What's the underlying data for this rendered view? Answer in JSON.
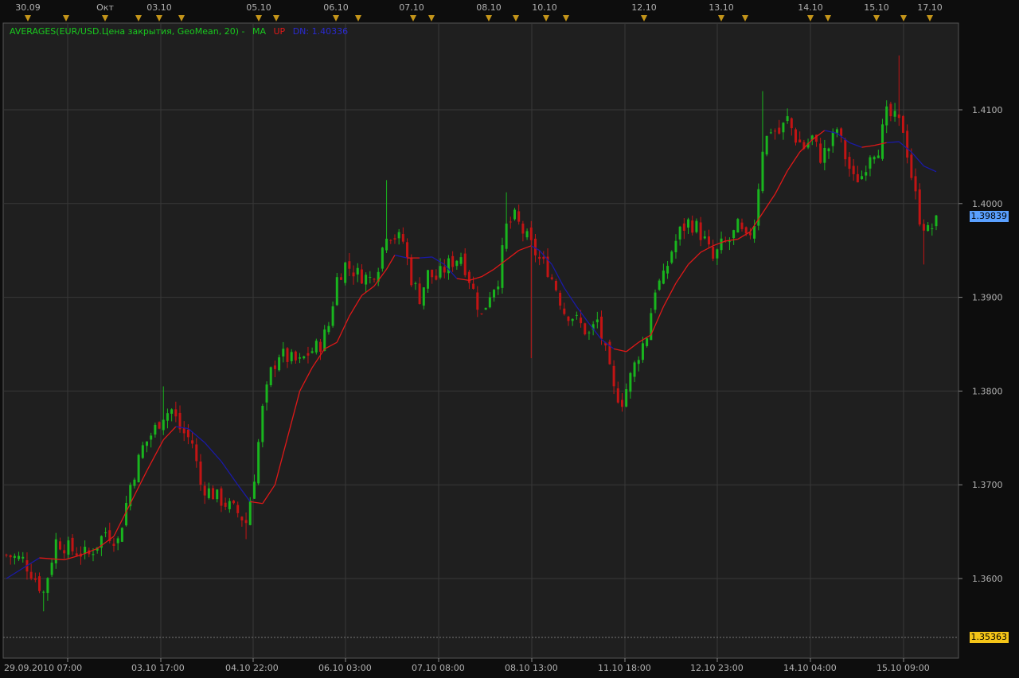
{
  "legend": {
    "indicator": "AVERAGES(EUR/USD.Цена закрытия, GeoMean, 20) -",
    "ma_label": "MA",
    "up_label": "UP",
    "dn_label": "DN: 1.40336"
  },
  "price_tags": {
    "current": "1.39839",
    "low": "1.35363"
  },
  "top_axis_labels": [
    "30.09",
    "Окт",
    "03.10",
    "05.10",
    "06.10",
    "07.10",
    "08.10",
    "10.10",
    "12.10",
    "13.10",
    "14.10",
    "15.10",
    "17.10"
  ],
  "colors": {
    "background": "#0d0d0d",
    "plot_bg": "#1f1f1f",
    "grid": "#383838",
    "up_candle": "#19b51e",
    "down_candle": "#c21414",
    "ma_up": "#e01818",
    "ma_down": "#1a1aa6",
    "legend_text": "#19c81e",
    "marker": "#c4951a",
    "current_tag": "#5aa0ff",
    "low_tag": "#f5c518"
  },
  "chart_data": {
    "type": "candlestick",
    "instrument": "EUR/USD",
    "y_ticks": [
      {
        "value": 1.41,
        "label": "1.4100"
      },
      {
        "value": 1.4,
        "label": "1.4000"
      },
      {
        "value": 1.39,
        "label": "1.3900"
      },
      {
        "value": 1.38,
        "label": "1.3800"
      },
      {
        "value": 1.37,
        "label": "1.3700"
      },
      {
        "value": 1.36,
        "label": "1.3600"
      }
    ],
    "ylim": [
      1.3535,
      1.4195
    ],
    "x_labels": [
      "29.09.2010 07:00",
      "03.10 17:00",
      "04.10 22:00",
      "06.10 03:00",
      "07.10 08:00",
      "08.10 13:00",
      "11.10 18:00",
      "12.10 23:00",
      "14.10 04:00",
      "15.10 09:00"
    ],
    "close_path": [
      {
        "t": 0,
        "v": 1.3625
      },
      {
        "t": 4,
        "v": 1.362
      },
      {
        "t": 7,
        "v": 1.36
      },
      {
        "t": 9,
        "v": 1.3585
      },
      {
        "t": 12,
        "v": 1.364
      },
      {
        "t": 16,
        "v": 1.363
      },
      {
        "t": 20,
        "v": 1.3625
      },
      {
        "t": 24,
        "v": 1.365
      },
      {
        "t": 27,
        "v": 1.364
      },
      {
        "t": 30,
        "v": 1.37
      },
      {
        "t": 33,
        "v": 1.374
      },
      {
        "t": 36,
        "v": 1.376
      },
      {
        "t": 38,
        "v": 1.3775
      },
      {
        "t": 40,
        "v": 1.378
      },
      {
        "t": 42,
        "v": 1.376
      },
      {
        "t": 45,
        "v": 1.3745
      },
      {
        "t": 47,
        "v": 1.37
      },
      {
        "t": 50,
        "v": 1.369
      },
      {
        "t": 53,
        "v": 1.368
      },
      {
        "t": 56,
        "v": 1.367
      },
      {
        "t": 58,
        "v": 1.366
      },
      {
        "t": 60,
        "v": 1.371
      },
      {
        "t": 62,
        "v": 1.378
      },
      {
        "t": 64,
        "v": 1.382
      },
      {
        "t": 66,
        "v": 1.384
      },
      {
        "t": 68,
        "v": 1.3835
      },
      {
        "t": 71,
        "v": 1.383
      },
      {
        "t": 73,
        "v": 1.384
      },
      {
        "t": 76,
        "v": 1.385
      },
      {
        "t": 78,
        "v": 1.387
      },
      {
        "t": 80,
        "v": 1.392
      },
      {
        "t": 82,
        "v": 1.3935
      },
      {
        "t": 85,
        "v": 1.3925
      },
      {
        "t": 88,
        "v": 1.392
      },
      {
        "t": 90,
        "v": 1.3935
      },
      {
        "t": 92,
        "v": 1.397
      },
      {
        "t": 94,
        "v": 1.3965
      },
      {
        "t": 96,
        "v": 1.396
      },
      {
        "t": 98,
        "v": 1.392
      },
      {
        "t": 100,
        "v": 1.39
      },
      {
        "t": 102,
        "v": 1.3925
      },
      {
        "t": 104,
        "v": 1.392
      },
      {
        "t": 107,
        "v": 1.3935
      },
      {
        "t": 110,
        "v": 1.3945
      },
      {
        "t": 112,
        "v": 1.392
      },
      {
        "t": 115,
        "v": 1.388
      },
      {
        "t": 117,
        "v": 1.3905
      },
      {
        "t": 119,
        "v": 1.392
      },
      {
        "t": 121,
        "v": 1.3975
      },
      {
        "t": 123,
        "v": 1.3985
      },
      {
        "t": 125,
        "v": 1.397
      },
      {
        "t": 127,
        "v": 1.3955
      },
      {
        "t": 129,
        "v": 1.394
      },
      {
        "t": 131,
        "v": 1.393
      },
      {
        "t": 133,
        "v": 1.391
      },
      {
        "t": 135,
        "v": 1.3885
      },
      {
        "t": 137,
        "v": 1.388
      },
      {
        "t": 139,
        "v": 1.387
      },
      {
        "t": 141,
        "v": 1.386
      },
      {
        "t": 143,
        "v": 1.3875
      },
      {
        "t": 145,
        "v": 1.384
      },
      {
        "t": 147,
        "v": 1.38
      },
      {
        "t": 149,
        "v": 1.379
      },
      {
        "t": 151,
        "v": 1.3815
      },
      {
        "t": 153,
        "v": 1.384
      },
      {
        "t": 155,
        "v": 1.386
      },
      {
        "t": 157,
        "v": 1.391
      },
      {
        "t": 159,
        "v": 1.392
      },
      {
        "t": 161,
        "v": 1.395
      },
      {
        "t": 163,
        "v": 1.397
      },
      {
        "t": 165,
        "v": 1.398
      },
      {
        "t": 167,
        "v": 1.3975
      },
      {
        "t": 169,
        "v": 1.396
      },
      {
        "t": 171,
        "v": 1.394
      },
      {
        "t": 173,
        "v": 1.3955
      },
      {
        "t": 175,
        "v": 1.396
      },
      {
        "t": 177,
        "v": 1.3975
      },
      {
        "t": 179,
        "v": 1.396
      },
      {
        "t": 181,
        "v": 1.398
      },
      {
        "t": 183,
        "v": 1.406
      },
      {
        "t": 185,
        "v": 1.408
      },
      {
        "t": 187,
        "v": 1.4075
      },
      {
        "t": 189,
        "v": 1.409
      },
      {
        "t": 191,
        "v": 1.407
      },
      {
        "t": 193,
        "v": 1.406
      },
      {
        "t": 195,
        "v": 1.407
      },
      {
        "t": 197,
        "v": 1.405
      },
      {
        "t": 199,
        "v": 1.406
      },
      {
        "t": 201,
        "v": 1.408
      },
      {
        "t": 203,
        "v": 1.405
      },
      {
        "t": 205,
        "v": 1.4025
      },
      {
        "t": 207,
        "v": 1.403
      },
      {
        "t": 209,
        "v": 1.4055
      },
      {
        "t": 211,
        "v": 1.406
      },
      {
        "t": 213,
        "v": 1.4095
      },
      {
        "t": 215,
        "v": 1.409
      },
      {
        "t": 217,
        "v": 1.408
      },
      {
        "t": 219,
        "v": 1.403
      },
      {
        "t": 221,
        "v": 1.3985
      },
      {
        "t": 223,
        "v": 1.397
      },
      {
        "t": 225,
        "v": 1.398
      }
    ],
    "ma_points": [
      {
        "t": 0,
        "v": 1.36,
        "trend": "down"
      },
      {
        "t": 8,
        "v": 1.3622,
        "trend": "down"
      },
      {
        "t": 14,
        "v": 1.362,
        "trend": "up"
      },
      {
        "t": 18,
        "v": 1.3625,
        "trend": "up"
      },
      {
        "t": 22,
        "v": 1.3632,
        "trend": "up"
      },
      {
        "t": 26,
        "v": 1.3645,
        "trend": "up"
      },
      {
        "t": 30,
        "v": 1.368,
        "trend": "up"
      },
      {
        "t": 34,
        "v": 1.3715,
        "trend": "up"
      },
      {
        "t": 38,
        "v": 1.3748,
        "trend": "up"
      },
      {
        "t": 41,
        "v": 1.3762,
        "trend": "up"
      },
      {
        "t": 44,
        "v": 1.376,
        "trend": "down"
      },
      {
        "t": 48,
        "v": 1.3745,
        "trend": "down"
      },
      {
        "t": 52,
        "v": 1.3725,
        "trend": "down"
      },
      {
        "t": 56,
        "v": 1.37,
        "trend": "down"
      },
      {
        "t": 59,
        "v": 1.3682,
        "trend": "down"
      },
      {
        "t": 62,
        "v": 1.368,
        "trend": "up"
      },
      {
        "t": 65,
        "v": 1.37,
        "trend": "up"
      },
      {
        "t": 68,
        "v": 1.375,
        "trend": "up"
      },
      {
        "t": 71,
        "v": 1.38,
        "trend": "up"
      },
      {
        "t": 74,
        "v": 1.3825,
        "trend": "up"
      },
      {
        "t": 77,
        "v": 1.3845,
        "trend": "up"
      },
      {
        "t": 80,
        "v": 1.3852,
        "trend": "up"
      },
      {
        "t": 83,
        "v": 1.388,
        "trend": "up"
      },
      {
        "t": 86,
        "v": 1.3902,
        "trend": "up"
      },
      {
        "t": 89,
        "v": 1.3912,
        "trend": "up"
      },
      {
        "t": 92,
        "v": 1.393,
        "trend": "up"
      },
      {
        "t": 94,
        "v": 1.3945,
        "trend": "up"
      },
      {
        "t": 97,
        "v": 1.3942,
        "trend": "down"
      },
      {
        "t": 100,
        "v": 1.3942,
        "trend": "up"
      },
      {
        "t": 103,
        "v": 1.3943,
        "trend": "down"
      },
      {
        "t": 106,
        "v": 1.3935,
        "trend": "down"
      },
      {
        "t": 109,
        "v": 1.392,
        "trend": "down"
      },
      {
        "t": 112,
        "v": 1.3918,
        "trend": "up"
      },
      {
        "t": 115,
        "v": 1.3922,
        "trend": "up"
      },
      {
        "t": 118,
        "v": 1.393,
        "trend": "up"
      },
      {
        "t": 121,
        "v": 1.394,
        "trend": "up"
      },
      {
        "t": 124,
        "v": 1.395,
        "trend": "up"
      },
      {
        "t": 127,
        "v": 1.3955,
        "trend": "up"
      },
      {
        "t": 129,
        "v": 1.395,
        "trend": "down"
      },
      {
        "t": 132,
        "v": 1.3935,
        "trend": "down"
      },
      {
        "t": 135,
        "v": 1.391,
        "trend": "down"
      },
      {
        "t": 138,
        "v": 1.389,
        "trend": "down"
      },
      {
        "t": 141,
        "v": 1.3872,
        "trend": "down"
      },
      {
        "t": 144,
        "v": 1.3855,
        "trend": "down"
      },
      {
        "t": 147,
        "v": 1.3845,
        "trend": "down"
      },
      {
        "t": 150,
        "v": 1.3842,
        "trend": "up"
      },
      {
        "t": 153,
        "v": 1.3852,
        "trend": "up"
      },
      {
        "t": 156,
        "v": 1.386,
        "trend": "up"
      },
      {
        "t": 159,
        "v": 1.389,
        "trend": "up"
      },
      {
        "t": 162,
        "v": 1.3915,
        "trend": "up"
      },
      {
        "t": 165,
        "v": 1.3935,
        "trend": "up"
      },
      {
        "t": 168,
        "v": 1.3948,
        "trend": "up"
      },
      {
        "t": 171,
        "v": 1.3955,
        "trend": "up"
      },
      {
        "t": 174,
        "v": 1.396,
        "trend": "up"
      },
      {
        "t": 177,
        "v": 1.3962,
        "trend": "up"
      },
      {
        "t": 180,
        "v": 1.397,
        "trend": "up"
      },
      {
        "t": 183,
        "v": 1.399,
        "trend": "up"
      },
      {
        "t": 186,
        "v": 1.401,
        "trend": "up"
      },
      {
        "t": 189,
        "v": 1.4035,
        "trend": "up"
      },
      {
        "t": 192,
        "v": 1.4055,
        "trend": "up"
      },
      {
        "t": 195,
        "v": 1.4068,
        "trend": "up"
      },
      {
        "t": 198,
        "v": 1.4078,
        "trend": "up"
      },
      {
        "t": 201,
        "v": 1.4075,
        "trend": "down"
      },
      {
        "t": 204,
        "v": 1.4065,
        "trend": "down"
      },
      {
        "t": 207,
        "v": 1.406,
        "trend": "down"
      },
      {
        "t": 210,
        "v": 1.4062,
        "trend": "up"
      },
      {
        "t": 213,
        "v": 1.4065,
        "trend": "up"
      },
      {
        "t": 216,
        "v": 1.4066,
        "trend": "down"
      },
      {
        "t": 219,
        "v": 1.4055,
        "trend": "down"
      },
      {
        "t": 222,
        "v": 1.404,
        "trend": "down"
      },
      {
        "t": 225,
        "v": 1.4034,
        "trend": "down"
      }
    ],
    "special_highs": [
      {
        "t": 38,
        "v": 1.3805
      },
      {
        "t": 92,
        "v": 1.4025
      },
      {
        "t": 121,
        "v": 1.4012
      },
      {
        "t": 183,
        "v": 1.412
      },
      {
        "t": 216,
        "v": 1.4158
      }
    ],
    "special_lows": [
      {
        "t": 9,
        "v": 1.3565
      },
      {
        "t": 149,
        "v": 1.3778
      },
      {
        "t": 127,
        "v": 1.3835
      },
      {
        "t": 58,
        "v": 1.3642
      },
      {
        "t": 222,
        "v": 1.3935
      }
    ]
  }
}
